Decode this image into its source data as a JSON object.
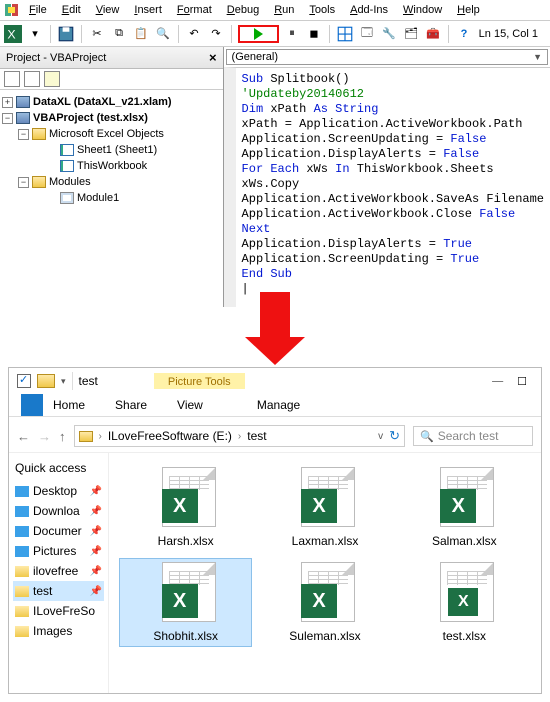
{
  "menubar": [
    "File",
    "Edit",
    "View",
    "Insert",
    "Format",
    "Debug",
    "Run",
    "Tools",
    "Add-Ins",
    "Window",
    "Help"
  ],
  "lncol": "Ln 15, Col 1",
  "project": {
    "title": "Project - VBAProject",
    "items": {
      "dataxl": "DataXL (DataXL_v21.xlam)",
      "vbaproj": "VBAProject (test.xlsx)",
      "excelobj": "Microsoft Excel Objects",
      "sheet1": "Sheet1 (Sheet1)",
      "thiswb": "ThisWorkbook",
      "modules": "Modules",
      "module1": "Module1"
    }
  },
  "combo": "(General)",
  "code": {
    "l1a": "Sub",
    "l1b": " Splitbook()",
    "l2": "'Updateby20140612",
    "l3a": "Dim",
    "l3b": " xPath ",
    "l3c": "As String",
    "l4": "xPath = Application.ActiveWorkbook.Path",
    "l5a": "Application.ScreenUpdating = ",
    "l5b": "False",
    "l6a": "Application.DisplayAlerts = ",
    "l6b": "False",
    "l7a": "For Each",
    "l7b": " xWs ",
    "l7c": "In",
    "l7d": " ThisWorkbook.Sheets",
    "l8": "xWs.Copy",
    "l9": "Application.ActiveWorkbook.SaveAs Filename",
    "l10a": "Application.ActiveWorkbook.Close ",
    "l10b": "False",
    "l11": "Next",
    "l12a": "Application.DisplayAlerts = ",
    "l12b": "True",
    "l13a": "Application.ScreenUpdating = ",
    "l13b": "True",
    "l14": "End Sub"
  },
  "explorer": {
    "title": "test",
    "pic_tools": "Picture Tools",
    "tabs": [
      "Home",
      "Share",
      "View",
      "Manage"
    ],
    "path_drive": "ILoveFreeSoftware (E:)",
    "path_folder": "test",
    "search_placeholder": "Search test",
    "quick_access": "Quick access",
    "side": [
      "Desktop",
      "Downloa",
      "Documer",
      "Pictures",
      "ilovefree",
      "test",
      "ILoveFreSo",
      "Images"
    ],
    "files": [
      "Harsh.xlsx",
      "Laxman.xlsx",
      "Salman.xlsx",
      "Shobhit.xlsx",
      "Suleman.xlsx",
      "test.xlsx"
    ]
  }
}
